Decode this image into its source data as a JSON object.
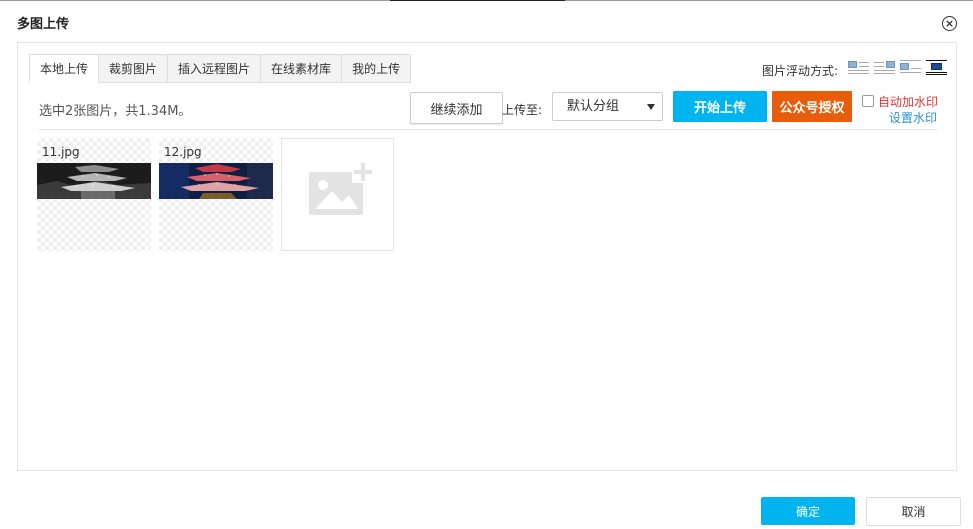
{
  "dialog": {
    "title": "多图上传"
  },
  "tabs": [
    {
      "label": "本地上传",
      "active": true
    },
    {
      "label": "裁剪图片",
      "active": false
    },
    {
      "label": "插入远程图片",
      "active": false
    },
    {
      "label": "在线素材库",
      "active": false
    },
    {
      "label": "我的上传",
      "active": false
    }
  ],
  "float_mode": {
    "label": "图片浮动方式:",
    "options": [
      "float-left-icon",
      "float-right-icon",
      "inline-icon",
      "center-icon"
    ],
    "selected": 3
  },
  "toolbar": {
    "status": "选中2张图片，共1.34M。",
    "continue_label": "继续添加",
    "upload_to_label": "上传至:",
    "group_selected": "默认分组",
    "start_label": "开始上传",
    "wechat_label": "公众号授权",
    "watermark_label": "自动加水印",
    "watermark_checked": false,
    "watermark_settings": "设置水印"
  },
  "files": [
    {
      "name": "11.jpg"
    },
    {
      "name": "12.jpg"
    }
  ],
  "footer": {
    "ok_label": "确定",
    "cancel_label": "取消"
  },
  "colors": {
    "primary": "#00b4f0",
    "wechat": "#e85d0c",
    "watermark_label": "#e23636",
    "link": "#2a92d6"
  }
}
